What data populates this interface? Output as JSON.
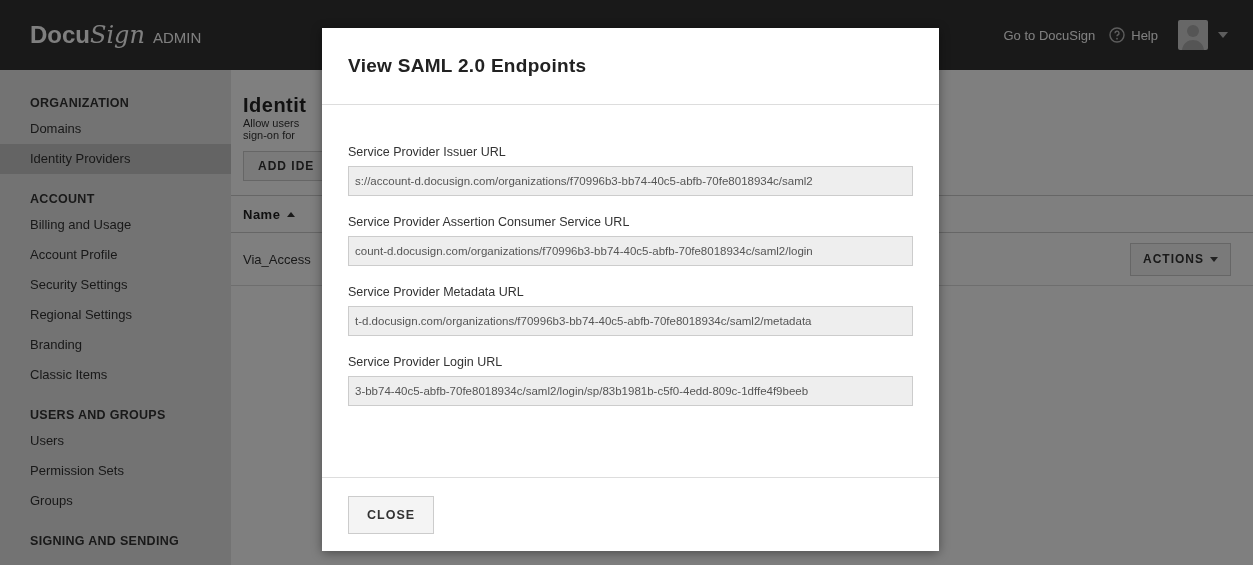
{
  "topbar": {
    "logo_main": "Docu",
    "logo_script": "Sign",
    "logo_suffix": "ADMIN",
    "go_link": "Go to DocuSign",
    "help_link": "Help"
  },
  "sidebar": {
    "sections": [
      {
        "title": "ORGANIZATION",
        "items": [
          {
            "label": "Domains",
            "selected": false
          },
          {
            "label": "Identity Providers",
            "selected": true
          }
        ]
      },
      {
        "title": "ACCOUNT",
        "items": [
          {
            "label": "Billing and Usage",
            "selected": false
          },
          {
            "label": "Account Profile",
            "selected": false
          },
          {
            "label": "Security Settings",
            "selected": false
          },
          {
            "label": "Regional Settings",
            "selected": false
          },
          {
            "label": "Branding",
            "selected": false
          },
          {
            "label": "Classic Items",
            "selected": false
          }
        ]
      },
      {
        "title": "USERS AND GROUPS",
        "items": [
          {
            "label": "Users",
            "selected": false
          },
          {
            "label": "Permission Sets",
            "selected": false
          },
          {
            "label": "Groups",
            "selected": false
          }
        ]
      },
      {
        "title": "SIGNING AND SENDING"
      }
    ]
  },
  "main": {
    "title": "Identit",
    "description_lines": [
      "Allow users",
      "sign-on for"
    ],
    "add_button": "ADD IDE",
    "table": {
      "columns": [
        {
          "label": "Name"
        }
      ],
      "rows": [
        {
          "name": "Via_Access",
          "action": "ACTIONS"
        }
      ]
    }
  },
  "modal": {
    "title": "View SAML 2.0 Endpoints",
    "fields": [
      {
        "label": "Service Provider Issuer URL",
        "value": "s://account-d.docusign.com/organizations/f70996b3-bb74-40c5-abfb-70fe8018934c/saml2"
      },
      {
        "label": "Service Provider Assertion Consumer Service URL",
        "value": "count-d.docusign.com/organizations/f70996b3-bb74-40c5-abfb-70fe8018934c/saml2/login"
      },
      {
        "label": "Service Provider Metadata URL",
        "value": "t-d.docusign.com/organizations/f70996b3-bb74-40c5-abfb-70fe8018934c/saml2/metadata"
      },
      {
        "label": "Service Provider Login URL",
        "value": "3-bb74-40c5-abfb-70fe8018934c/saml2/login/sp/83b1981b-c5f0-4edd-809c-1dffe4f9beeb"
      }
    ],
    "close_button": "CLOSE"
  }
}
